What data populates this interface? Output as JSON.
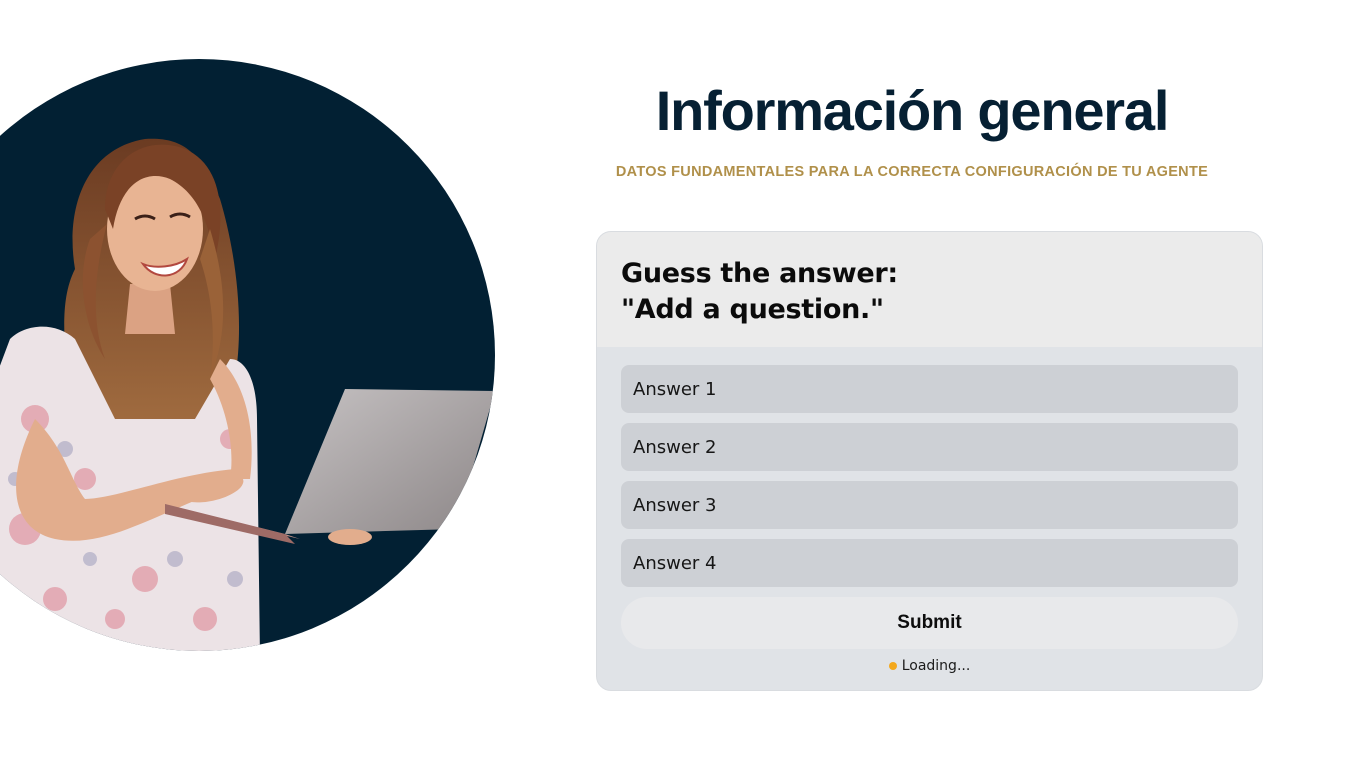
{
  "header": {
    "title": "Información general",
    "subtitle": "DATOS FUNDAMENTALES PARA LA CORRECTA CONFIGURACIÓN DE TU AGENTE"
  },
  "quiz": {
    "prompt": "Guess the answer:",
    "question": "\"Add a question.\"",
    "answers": [
      {
        "label": "Answer 1"
      },
      {
        "label": "Answer 2"
      },
      {
        "label": "Answer 3"
      },
      {
        "label": "Answer 4"
      }
    ],
    "submit_label": "Submit",
    "status_text": "Loading...",
    "status_color": "#f3a81c"
  },
  "colors": {
    "title": "#062033",
    "subtitle": "#b0904a",
    "circle": "#022033"
  }
}
